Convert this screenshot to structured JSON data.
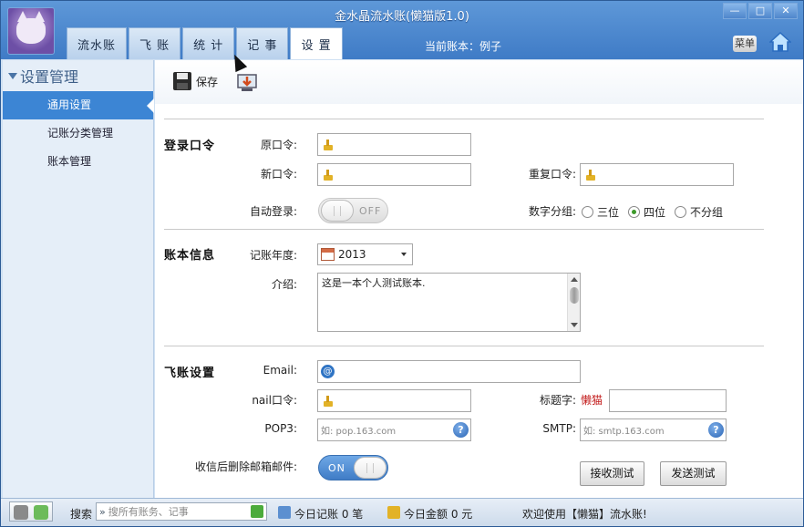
{
  "window": {
    "title": "金水晶流水账(懒猫版1.0)",
    "minimize": "—",
    "maximize": "□",
    "close": "✕"
  },
  "tabs": [
    "流水账",
    "飞 账",
    "统 计",
    "记 事",
    "设 置"
  ],
  "header": {
    "current_account": "当前账本：例子",
    "menu_label": "菜单"
  },
  "sidebar": {
    "title": "设置管理",
    "items": [
      {
        "label": "通用设置",
        "active": true
      },
      {
        "label": "记账分类管理",
        "active": false
      },
      {
        "label": "账本管理",
        "active": false
      }
    ]
  },
  "toolbar": {
    "save_label": "保存"
  },
  "login": {
    "section": "登录口令",
    "old_pwd_label": "原口令:",
    "new_pwd_label": "新口令:",
    "repeat_pwd_label": "重复口令:",
    "auto_login_label": "自动登录:",
    "auto_login_state": "OFF",
    "digit_group_label": "数字分组:",
    "digit_options": [
      "三位",
      "四位",
      "不分组"
    ],
    "digit_selected": "四位"
  },
  "account_info": {
    "section": "账本信息",
    "year_label": "记账年度:",
    "year_value": "2013",
    "intro_label": "介绍:",
    "intro_value": "这是一本个人测试账本."
  },
  "fly": {
    "section": "飞账设置",
    "email_label": "Email:",
    "mail_pwd_label": "nail口令:",
    "subject_label": "标题字:",
    "subject_tag": "懒猫",
    "pop3_label": "POP3:",
    "pop3_placeholder": "如: pop.163.com",
    "smtp_label": "SMTP:",
    "smtp_placeholder": "如: smtp.163.com",
    "delete_label": "收信后删除邮箱邮件:",
    "delete_state": "ON",
    "recv_test": "接收测试",
    "send_test": "发送测试"
  },
  "statusbar": {
    "search_label": "搜索",
    "search_placeholder": "搜所有账务、记事",
    "today_records": "今日记账 0 笔",
    "today_amount": "今日金额 0 元",
    "welcome": "欢迎使用【懒猫】流水账!"
  },
  "colors": {
    "accent": "#3c85d4",
    "title_bg": "#4a7cc0",
    "subject_tag": "#c21a1a",
    "radio_checked": "#3c9a2a"
  }
}
